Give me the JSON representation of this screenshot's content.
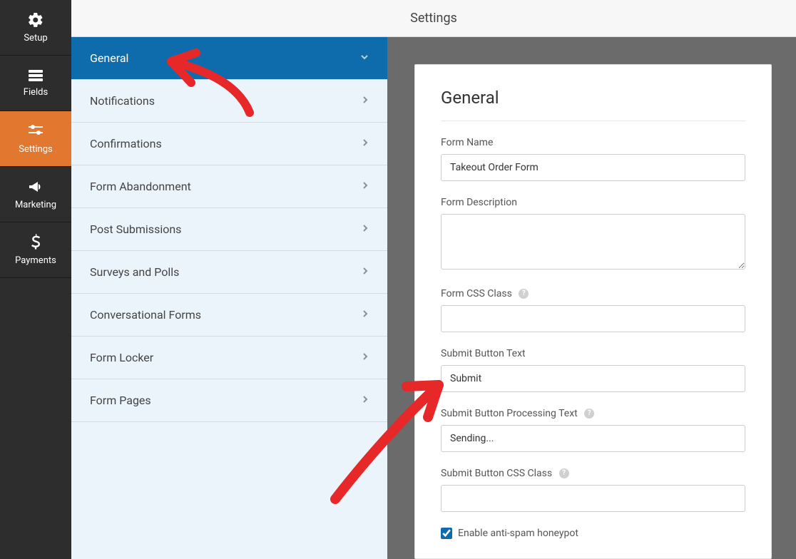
{
  "topbar": {
    "title": "Settings"
  },
  "left_nav": {
    "items": [
      {
        "key": "setup",
        "label": "Setup"
      },
      {
        "key": "fields",
        "label": "Fields"
      },
      {
        "key": "settings",
        "label": "Settings"
      },
      {
        "key": "marketing",
        "label": "Marketing"
      },
      {
        "key": "payments",
        "label": "Payments"
      }
    ]
  },
  "submenu": {
    "items": [
      {
        "label": "General",
        "active": true
      },
      {
        "label": "Notifications"
      },
      {
        "label": "Confirmations"
      },
      {
        "label": "Form Abandonment"
      },
      {
        "label": "Post Submissions"
      },
      {
        "label": "Surveys and Polls"
      },
      {
        "label": "Conversational Forms"
      },
      {
        "label": "Form Locker"
      },
      {
        "label": "Form Pages"
      }
    ]
  },
  "panel": {
    "heading": "General",
    "fields": {
      "form_name": {
        "label": "Form Name",
        "value": "Takeout Order Form"
      },
      "form_description": {
        "label": "Form Description",
        "value": ""
      },
      "form_css_class": {
        "label": "Form CSS Class",
        "value": "",
        "help": true
      },
      "submit_button_text": {
        "label": "Submit Button Text",
        "value": "Submit"
      },
      "submit_button_processing_text": {
        "label": "Submit Button Processing Text",
        "value": "Sending...",
        "help": true
      },
      "submit_button_css_class": {
        "label": "Submit Button CSS Class",
        "value": "",
        "help": true
      }
    },
    "checkbox": {
      "label": "Enable anti-spam honeypot",
      "checked": true
    }
  }
}
